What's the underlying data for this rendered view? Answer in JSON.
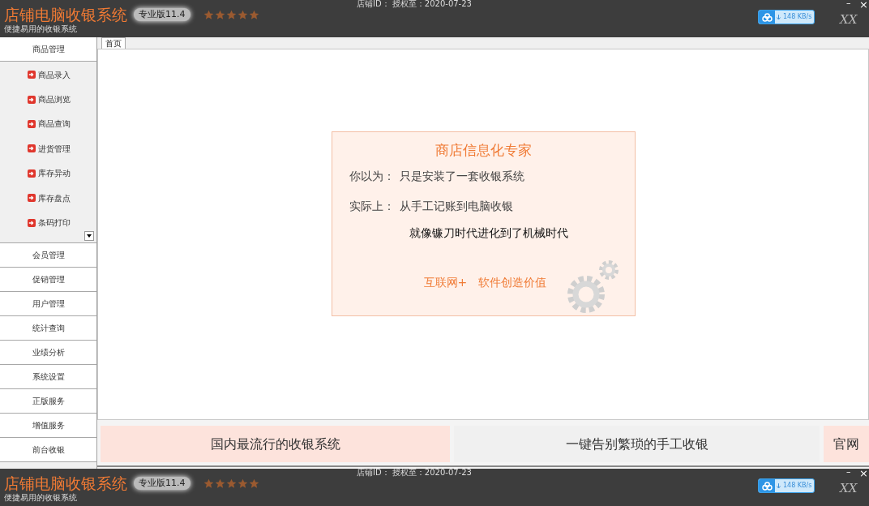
{
  "title_bars": [
    {
      "app_name": "店铺电脑收银系统",
      "edition": "专业版11.4",
      "stars": 5,
      "subtitle": "便捷易用的收银系统",
      "shop_info": "店铺ID： 授权至：2020-07-23",
      "speed": "148 KB/s",
      "user": "XX",
      "minimize": "–",
      "close": "×"
    },
    {
      "app_name": "店铺电脑收银系统",
      "edition": "专业版11.4",
      "stars": 5,
      "subtitle": "便捷易用的收银系统",
      "shop_info": "店铺ID： 授权至：2020-07-23",
      "speed": "148 KB/s",
      "user": "XX",
      "minimize": "–",
      "close": "×"
    }
  ],
  "sidebar": {
    "groups": [
      {
        "label": "商品管理",
        "children": [
          "商品录入",
          "商品浏览",
          "商品查询",
          "进货管理",
          "库存异动",
          "库存盘点",
          "条码打印"
        ]
      },
      {
        "label": "会员管理"
      },
      {
        "label": "促销管理"
      },
      {
        "label": "用户管理"
      },
      {
        "label": "统计查询"
      },
      {
        "label": "业绩分析"
      },
      {
        "label": "系统设置"
      },
      {
        "label": "正版服务"
      },
      {
        "label": "增值服务"
      },
      {
        "label": "前台收银"
      }
    ]
  },
  "tabs": [
    {
      "label": "首页",
      "selected": true
    }
  ],
  "promo_card": {
    "title": "商店信息化专家",
    "lines": [
      {
        "label": "你以为：",
        "text": "只是安装了一套收银系统"
      },
      {
        "label": "实际上：",
        "text": "从手工记账到电脑收银"
      }
    ],
    "highlight": "就像镰刀时代进化到了机械时代",
    "slogans": [
      "互联网+",
      "软件创造价值"
    ]
  },
  "banners": [
    {
      "text": "国内最流行的收银系统",
      "kind": "pink"
    },
    {
      "text": "一键告别繁琐的手工收银",
      "kind": "gray"
    },
    {
      "text": "官网",
      "kind": "pink"
    }
  ]
}
